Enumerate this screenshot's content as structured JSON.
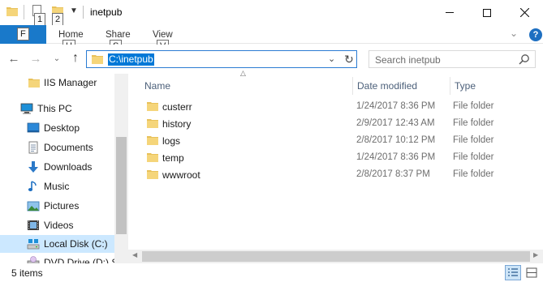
{
  "window": {
    "title": "inetpub"
  },
  "keytips": {
    "qat_props": "1",
    "qat_newfolder": "2",
    "file": "F",
    "home": "H",
    "share": "S",
    "view": "V"
  },
  "ribbon": {
    "tabs": [
      "Home",
      "Share",
      "View"
    ]
  },
  "address": {
    "path": "C:\\inetpub"
  },
  "search": {
    "placeholder": "Search inetpub"
  },
  "nav": {
    "items": [
      {
        "label": "IIS Manager",
        "icon": "folder-icon"
      },
      {
        "label": "This PC",
        "icon": "computer-icon"
      },
      {
        "label": "Desktop",
        "icon": "desktop-icon"
      },
      {
        "label": "Documents",
        "icon": "documents-icon"
      },
      {
        "label": "Downloads",
        "icon": "downloads-icon"
      },
      {
        "label": "Music",
        "icon": "music-icon"
      },
      {
        "label": "Pictures",
        "icon": "pictures-icon"
      },
      {
        "label": "Videos",
        "icon": "videos-icon"
      },
      {
        "label": "Local Disk (C:)",
        "icon": "drive-icon",
        "selected": true
      },
      {
        "label": "DVD Drive (D:) S",
        "icon": "dvd-drive-icon"
      }
    ]
  },
  "columns": {
    "name": "Name",
    "date": "Date modified",
    "type": "Type"
  },
  "files": [
    {
      "name": "custerr",
      "date": "1/24/2017 8:36 PM",
      "type": "File folder"
    },
    {
      "name": "history",
      "date": "2/9/2017 12:43 AM",
      "type": "File folder"
    },
    {
      "name": "logs",
      "date": "2/8/2017 10:12 PM",
      "type": "File folder"
    },
    {
      "name": "temp",
      "date": "1/24/2017 8:36 PM",
      "type": "File folder"
    },
    {
      "name": "wwwroot",
      "date": "2/8/2017 8:37 PM",
      "type": "File folder"
    }
  ],
  "status": {
    "item_count": "5 items"
  },
  "colors": {
    "accent": "#0078d7",
    "file_tab": "#1979ca",
    "folder": "#e8c15a",
    "selection": "#cce8ff"
  }
}
